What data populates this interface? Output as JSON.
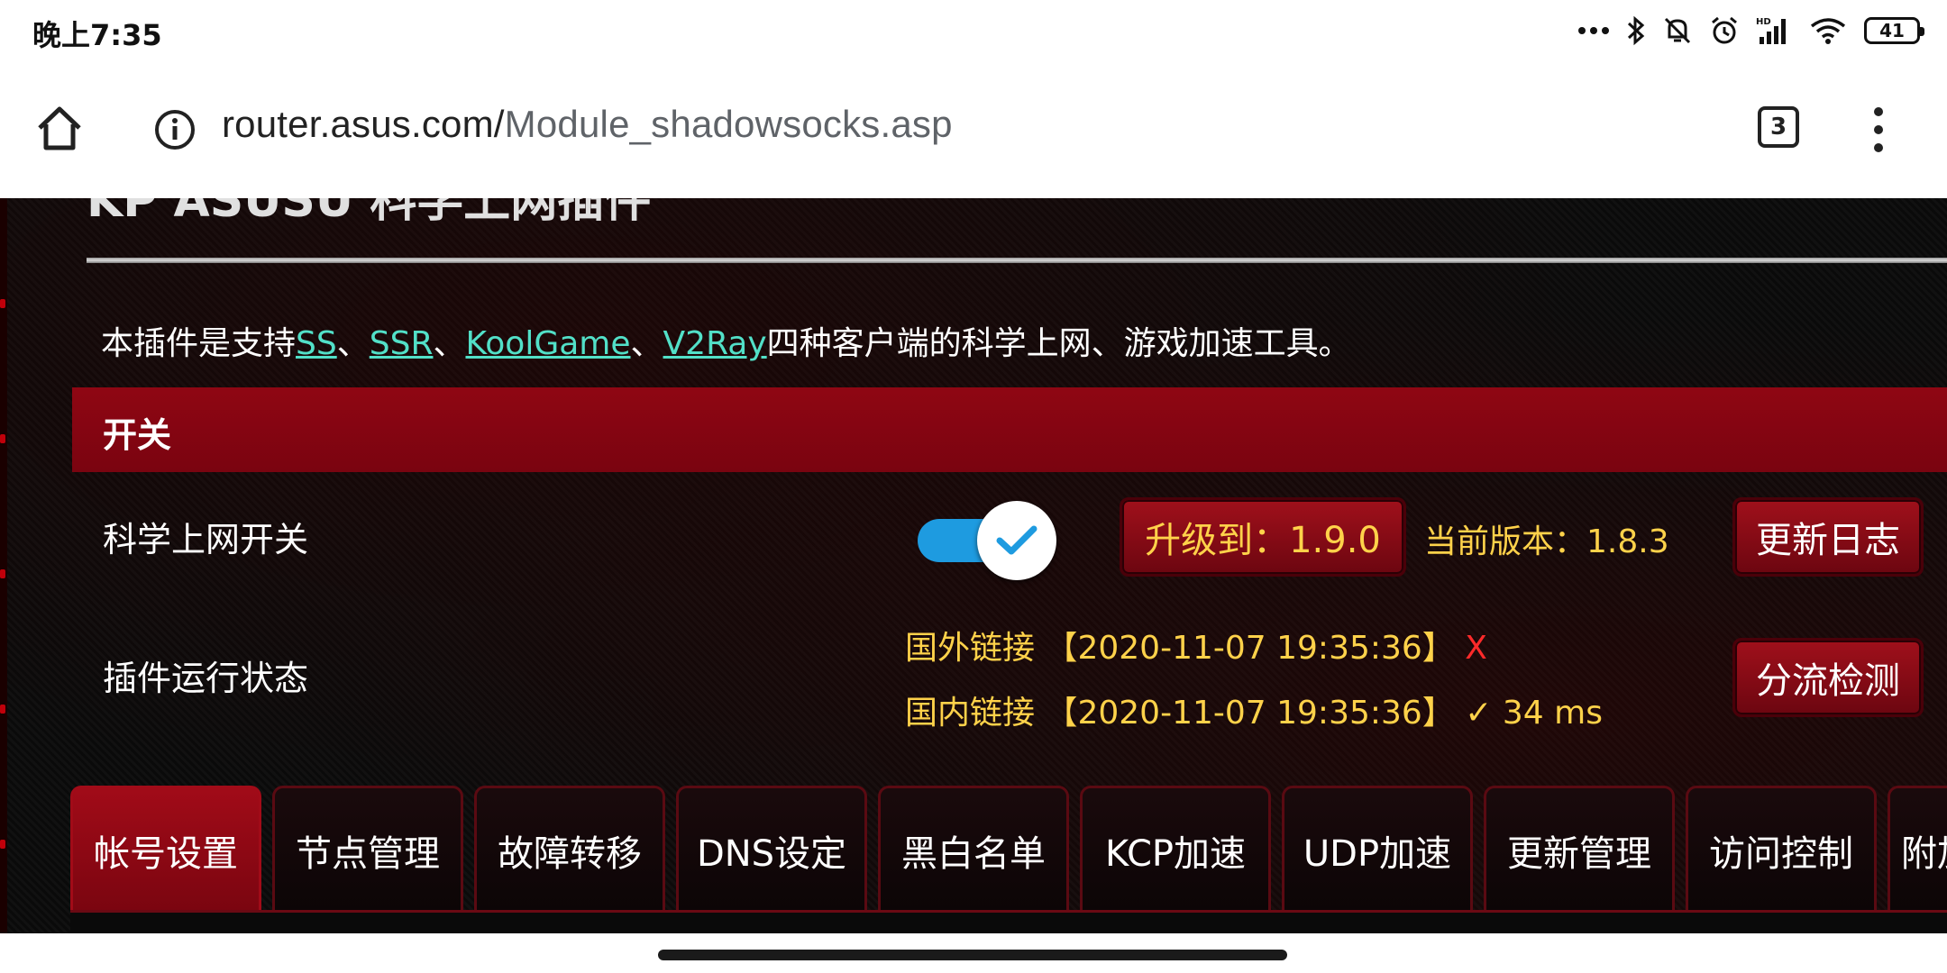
{
  "status_bar": {
    "time": "晚上7:35",
    "battery": "41",
    "icons": [
      "more-dots-icon",
      "bluetooth-icon",
      "mute-icon",
      "alarm-icon",
      "hd-signal-icon",
      "wifi-icon",
      "battery-icon"
    ]
  },
  "browser": {
    "url_host": "router.asus.com/",
    "url_path": "Module_shadowsocks.asp",
    "tab_count": "3"
  },
  "page": {
    "title": "KP ASUSU 科学上网插件",
    "intro": {
      "prefix": "本插件是支持",
      "link1": "SS",
      "sep1": "、",
      "link2": "SSR",
      "sep2": "、",
      "link3": "KoolGame",
      "sep3": "、",
      "link4": "V2Ray",
      "suffix": "四种客户端的科学上网、游戏加速工具。"
    },
    "section_header": "开关",
    "switch_row": {
      "label": "科学上网开关",
      "toggle_on": true,
      "upgrade_button": "升级到：1.9.0",
      "current_version": "当前版本：1.8.3",
      "changelog_button": "更新日志"
    },
    "status_row": {
      "label": "插件运行状态",
      "foreign_label": "国外链接",
      "foreign_time": "【2020-11-07 19:35:36】",
      "foreign_result": "X",
      "domestic_label": "国内链接",
      "domestic_time": "【2020-11-07 19:35:36】",
      "domestic_result": "✓ 34 ms",
      "detect_button": "分流检测"
    },
    "tabs": [
      {
        "label": "帐号设置",
        "active": true
      },
      {
        "label": "节点管理",
        "active": false
      },
      {
        "label": "故障转移",
        "active": false
      },
      {
        "label": "DNS设定",
        "active": false
      },
      {
        "label": "黑白名单",
        "active": false
      },
      {
        "label": "KCP加速",
        "active": false
      },
      {
        "label": "UDP加速",
        "active": false
      },
      {
        "label": "更新管理",
        "active": false
      },
      {
        "label": "访问控制",
        "active": false
      },
      {
        "label": "附加",
        "active": false
      }
    ]
  },
  "colors": {
    "accent_red": "#8f0613",
    "link_teal": "#52e0c8",
    "status_yellow": "#ffd24a",
    "toggle_blue": "#1e9be0"
  }
}
